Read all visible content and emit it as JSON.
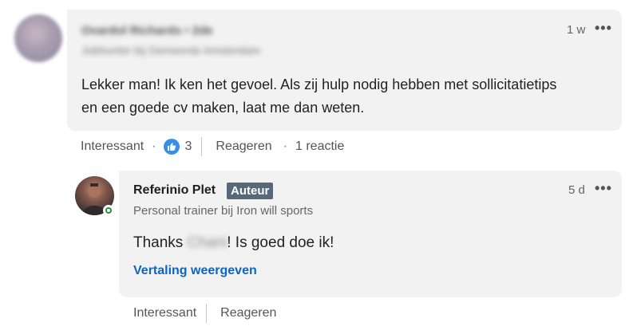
{
  "comment": {
    "author_name": "Ovardol Richards • 2de",
    "author_headline": "Jobhunter bij Gemeente Amsterdam",
    "time": "1 w",
    "more": "•••",
    "text": "Lekker man! Ik ken het gevoel. Als zij hulp nodig hebben met sollicitatietips en een goede cv maken, laat me dan weten.",
    "actions": {
      "like_label": "Interessant",
      "dot": "·",
      "reaction_count": "3",
      "reply_label": "Reageren",
      "replies_count_label": "1 reactie"
    }
  },
  "reply": {
    "author_name": "Referinio Plet",
    "author_badge": "Auteur",
    "author_headline": "Personal trainer bij Iron will sports",
    "time": "5 d",
    "more": "•••",
    "text_before": "Thanks ",
    "text_blurred_name": "Chani",
    "text_after": "! Is goed doe ik!",
    "translate_label": "Vertaling weergeven",
    "actions": {
      "like_label": "Interessant",
      "reply_label": "Reageren"
    }
  },
  "colors": {
    "bubble_bg": "#f2f2f2",
    "link": "#0a66c2",
    "badge_bg": "#56687a",
    "like_icon": "#378fe9",
    "online": "#2e8b3e"
  }
}
